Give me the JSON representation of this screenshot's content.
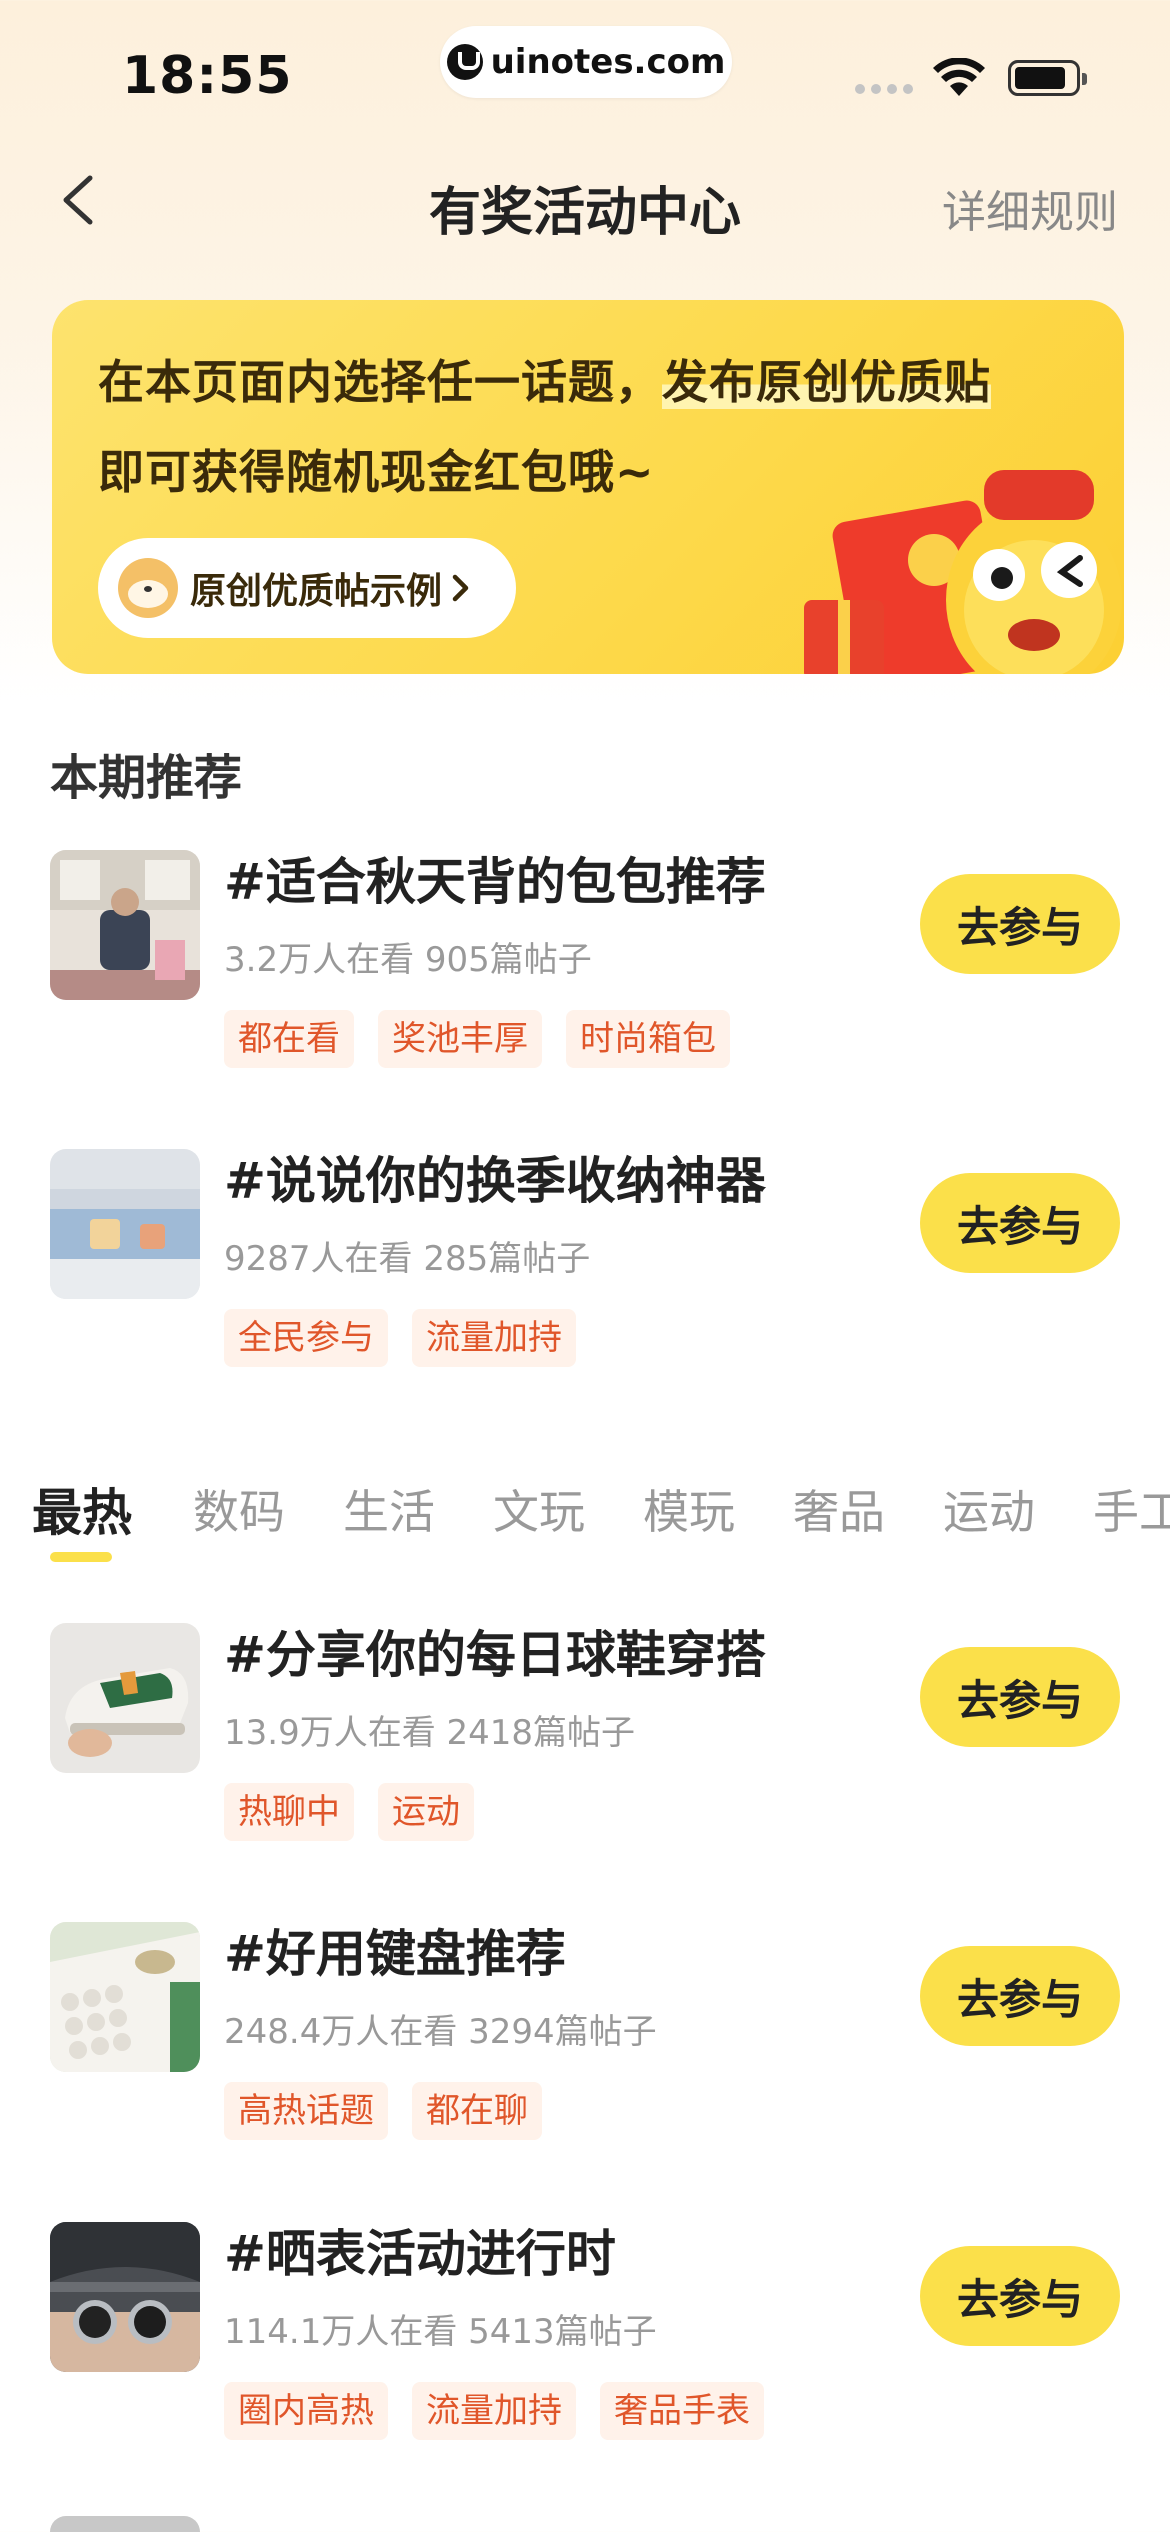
{
  "status_bar": {
    "time": "18:55",
    "url": "uinotes.com"
  },
  "nav": {
    "title": "有奖活动中心",
    "rules_label": "详细规则",
    "back_icon": "chevron-left-icon"
  },
  "banner": {
    "line1_plain": "在本页面内选择任一话题，",
    "line1_highlight": "发布原创优质贴",
    "line2": "即可获得随机现金红包哦~",
    "example_button": "原创优质帖示例"
  },
  "featured": {
    "section_title": "本期推荐",
    "topics": [
      {
        "title": "#适合秋天背的包包推荐",
        "stats": "3.2万人在看 905篇帖子",
        "tags": [
          "都在看",
          "奖池丰厚",
          "时尚箱包"
        ],
        "button": "去参与"
      },
      {
        "title": "#说说你的换季收纳神器",
        "stats": "9287人在看 285篇帖子",
        "tags": [
          "全民参与",
          "流量加持"
        ],
        "button": "去参与"
      }
    ]
  },
  "tabs": [
    "最热",
    "数码",
    "生活",
    "文玩",
    "模玩",
    "奢品",
    "运动",
    "手工"
  ],
  "active_tab": "最热",
  "hot": {
    "topics": [
      {
        "title": "#分享你的每日球鞋穿搭",
        "stats": "13.9万人在看 2418篇帖子",
        "tags": [
          "热聊中",
          "运动"
        ],
        "button": "去参与"
      },
      {
        "title": "#好用键盘推荐",
        "stats": "248.4万人在看 3294篇帖子",
        "tags": [
          "高热话题",
          "都在聊"
        ],
        "button": "去参与"
      },
      {
        "title": "#晒表活动进行时",
        "stats": "114.1万人在看 5413篇帖子",
        "tags": [
          "圈内高热",
          "流量加持",
          "奢品手表"
        ],
        "button": "去参与"
      }
    ]
  },
  "colors": {
    "accent_yellow": "#fbe04a",
    "tag_text": "#e0562a",
    "tag_bg": "#fff2ea"
  }
}
